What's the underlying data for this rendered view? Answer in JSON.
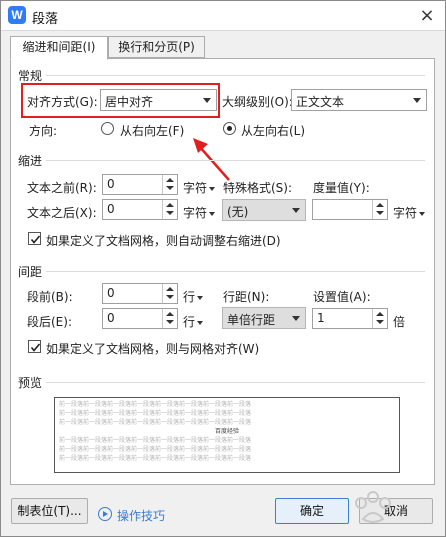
{
  "window": {
    "title": "段落",
    "app_icon": "W",
    "close_glyph": "×"
  },
  "tabs": [
    {
      "label": "缩进和间距(I)",
      "active": true
    },
    {
      "label": "换行和分页(P)",
      "active": false
    }
  ],
  "general": {
    "title": "常规",
    "alignment_label": "对齐方式(G):",
    "alignment_value": "居中对齐",
    "outline_label": "大纲级别(O):",
    "outline_value": "正文文本",
    "direction_label": "方向:",
    "rtl_label": "从右向左(F)",
    "ltr_label": "从左向右(L)",
    "ltr_selected": true
  },
  "indent": {
    "title": "缩进",
    "before_label": "文本之前(R):",
    "before_value": "0",
    "before_unit": "字符",
    "after_label": "文本之后(X):",
    "after_value": "0",
    "after_unit": "字符",
    "special_label": "特殊格式(S):",
    "special_value": "(无)",
    "measure_label": "度量值(Y):",
    "measure_value": "",
    "measure_unit": "字符",
    "grid_checkbox_label": "如果定义了文档网格，则自动调整右缩进(D)",
    "grid_checked": true
  },
  "spacing": {
    "title": "间距",
    "before_label": "段前(B):",
    "before_value": "0",
    "before_unit": "行",
    "after_label": "段后(E):",
    "after_value": "0",
    "after_unit": "行",
    "line_label": "行距(N):",
    "line_value": "单倍行距",
    "setting_label": "设置值(A):",
    "setting_value": "1",
    "setting_unit": "倍",
    "grid_checkbox_label": "如果定义了文档网格，则与网格对齐(W)",
    "grid_checked": true
  },
  "preview": {
    "title": "预览",
    "filler": "前一段落前一段落前一段落前一段落前一段落前一段落前一段落前一段落",
    "sample": "百度经验"
  },
  "buttons": {
    "tabs_label": "制表位(T)...",
    "tips_label": "操作技巧",
    "ok_label": "确定",
    "cancel_label": "取消"
  },
  "colors": {
    "highlight": "#e02020",
    "arrow": "#e02020",
    "link": "#3a7bd5",
    "accent": "#2e7df5"
  }
}
